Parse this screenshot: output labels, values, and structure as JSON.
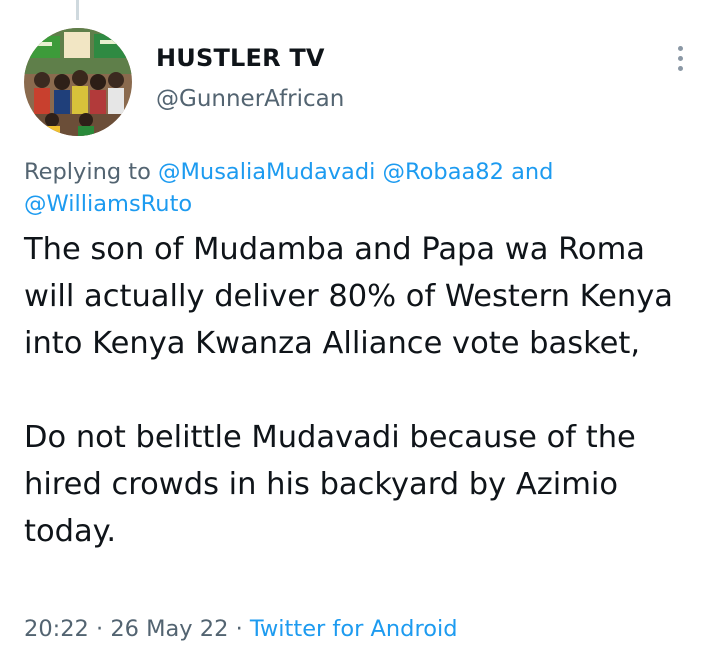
{
  "author": {
    "display_name": "HUSTLER TV",
    "handle": "@GunnerAfrican",
    "avatar_icon": "group-photo-avatar"
  },
  "menu": {
    "icon": "more-options-icon"
  },
  "reply_context": {
    "prefix": "Replying to",
    "mention_1": "@MusaliaMudavadi",
    "mention_2": "@Robaa82",
    "conjunction": "and",
    "mention_3": "@WilliamsRuto"
  },
  "tweet": {
    "paragraph_1": "The son of Mudamba and Papa wa Roma will actually deliver 80% of Western Kenya into Kenya Kwanza Alliance vote basket,",
    "paragraph_2": "Do not belittle Mudavadi because of the hired crowds in his backyard by Azimio today."
  },
  "meta": {
    "time": "20:22",
    "separator": "·",
    "date": "26 May 22",
    "source": "Twitter for Android"
  },
  "colors": {
    "text_primary": "#0f1419",
    "text_secondary": "#536471",
    "link": "#1d9bf0"
  }
}
